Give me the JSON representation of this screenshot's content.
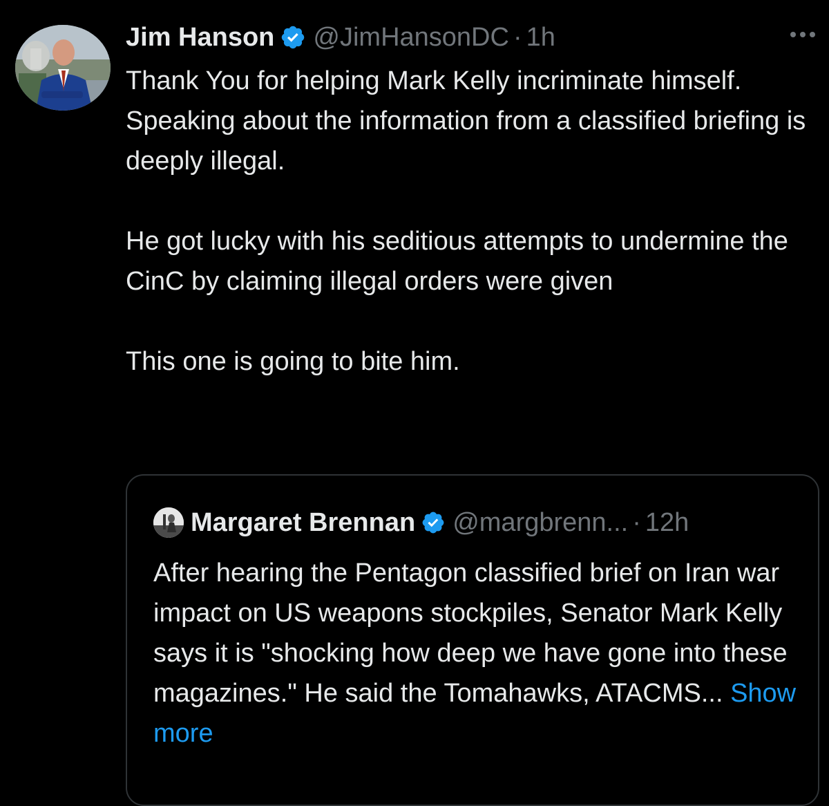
{
  "colors": {
    "background": "#000000",
    "text": "#e7e9ea",
    "secondary": "#71767b",
    "link": "#1d9bf0",
    "verified": "#1d9bf0",
    "border": "#2f3336"
  },
  "tweet": {
    "author": {
      "display_name": "Jim Hanson",
      "handle": "@JimHansonDC",
      "verified": true,
      "avatar_icon": "profile-photo"
    },
    "separator": "·",
    "time": "1h",
    "more_icon": "more-options-icon",
    "body": [
      "Thank You for helping Mark Kelly incriminate himself.",
      "Speaking about the information from a classified briefing is deeply illegal.",
      "",
      "He got lucky with his seditious attempts to undermine the CinC by claiming illegal orders were given",
      "",
      "This one is going to bite him."
    ]
  },
  "quoted_tweet": {
    "author": {
      "display_name": "Margaret Brennan",
      "handle": "@margbrenn...",
      "verified": true,
      "avatar_icon": "profile-photo"
    },
    "separator": "·",
    "time": "12h",
    "text": "After hearing the Pentagon classified brief on Iran war impact on US weapons stockpiles, Senator Mark Kelly says it is \"shocking how deep we have gone into these magazines.\" He said the Tomahawks, ATACMS...",
    "show_more": "Show more"
  }
}
